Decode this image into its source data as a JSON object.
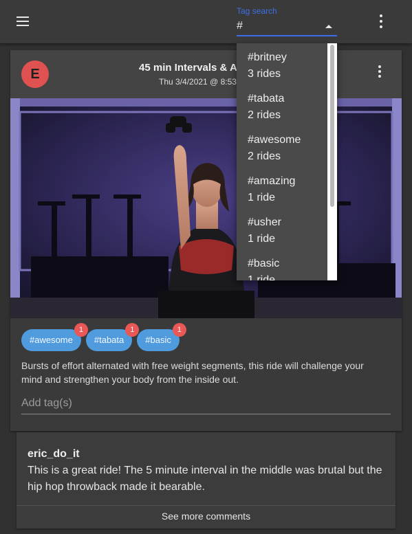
{
  "appbar": {
    "menu_icon": "menu-icon",
    "more_icon": "more-vert-icon",
    "tag_search": {
      "label": "Tag search",
      "value": "#"
    }
  },
  "tag_dropdown": {
    "items": [
      {
        "tag": "#britney",
        "count": "3 rides"
      },
      {
        "tag": "#tabata",
        "count": "2 rides"
      },
      {
        "tag": "#awesome",
        "count": "2 rides"
      },
      {
        "tag": "#amazing",
        "count": "1 ride"
      },
      {
        "tag": "#usher",
        "count": "1 ride"
      },
      {
        "tag": "#basic",
        "count": "1 ride"
      }
    ]
  },
  "ride_card": {
    "avatar_letter": "E",
    "title": "45 min Intervals & A",
    "date": "Thu 3/4/2021 @ 8:53",
    "more_icon": "more-vert-icon",
    "tags": [
      {
        "label": "#awesome",
        "badge": "1"
      },
      {
        "label": "#tabata",
        "badge": "1"
      },
      {
        "label": "#basic",
        "badge": "1"
      }
    ],
    "description": "Bursts of effort alternated with free weight segments, this ride will challenge your mind and strengthen your body from the inside out.",
    "add_tag_placeholder": "Add tag(s)"
  },
  "comment": {
    "user": "eric_do_it",
    "text": "This is a great ride! The 5 minute interval in the middle was brutal but the hip hop throwback made it bearable.",
    "see_more": "See more comments"
  },
  "colors": {
    "background": "#313131",
    "appbar": "#3a3a3a",
    "accent_blue": "#3f6fe8",
    "chip_blue": "#4f9bde",
    "badge_red": "#ea5757",
    "avatar_red": "#e05252"
  }
}
